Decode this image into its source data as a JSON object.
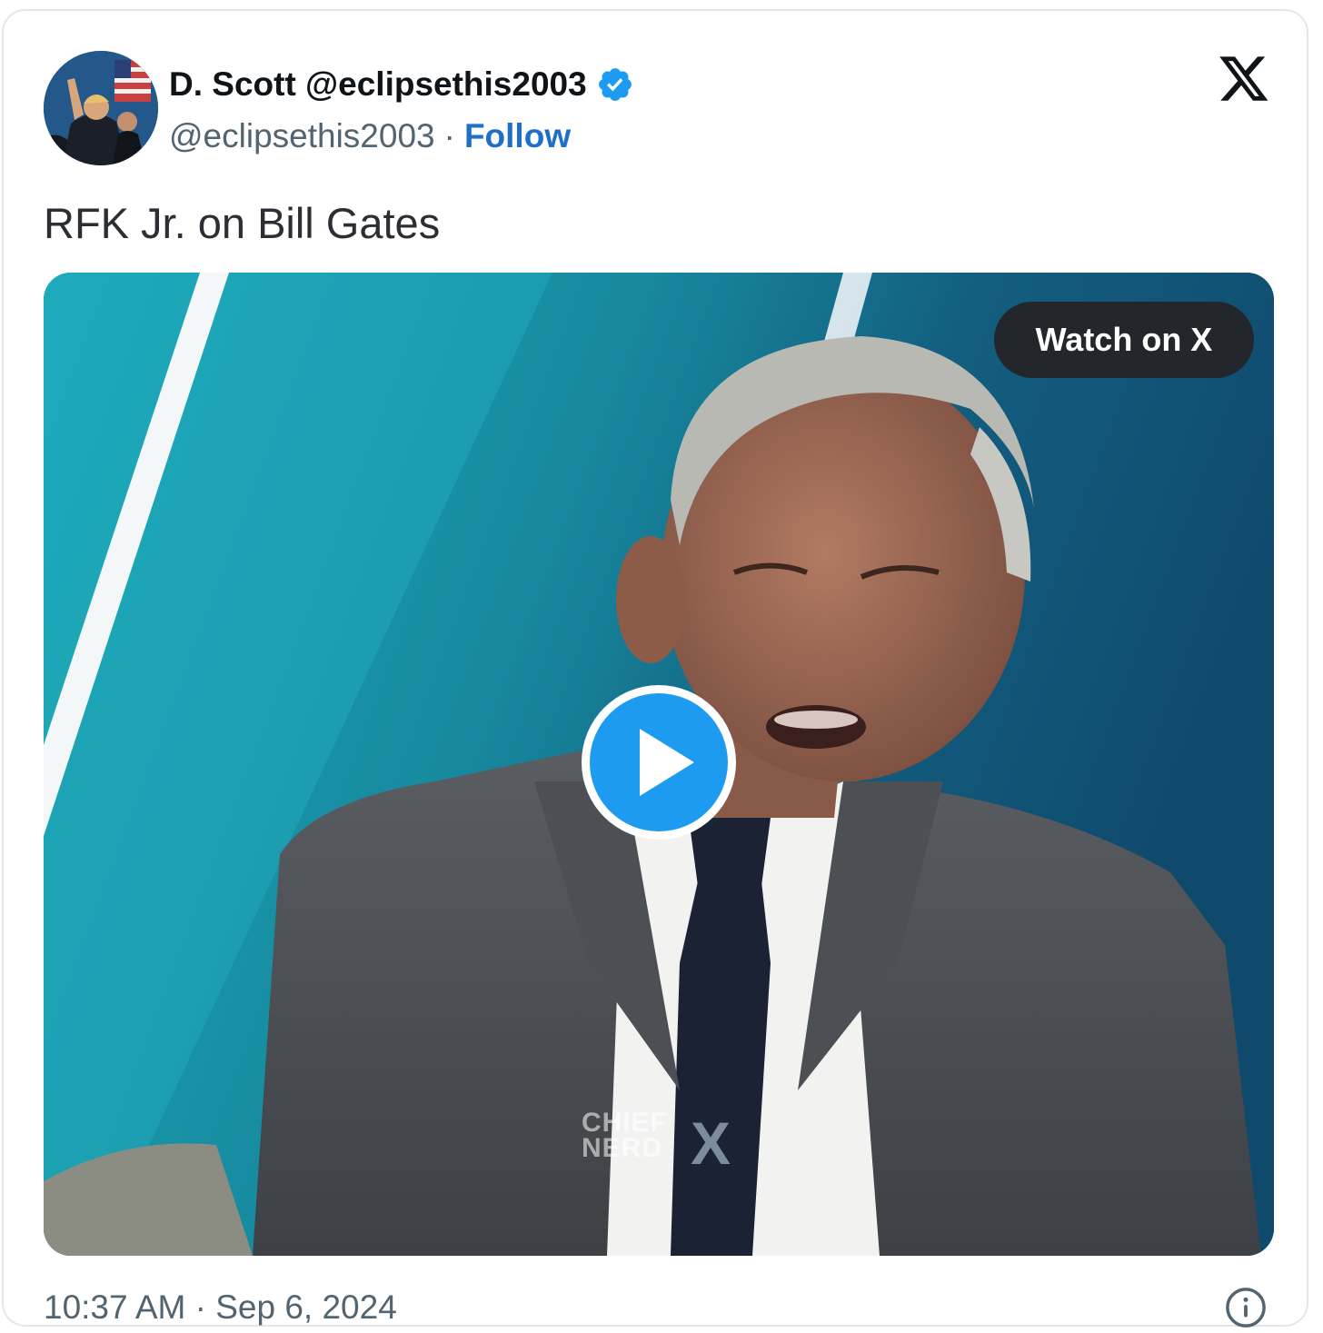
{
  "tweet": {
    "display_name": "D. Scott @eclipsethis2003",
    "handle": "@eclipsethis2003",
    "separator": "·",
    "follow_label": "Follow",
    "text": "RFK Jr. on Bill Gates",
    "timestamp": "10:37 AM · Sep 6, 2024",
    "verified": true
  },
  "media": {
    "watch_label": "Watch on X",
    "watermark_line1": "CHIEF",
    "watermark_line2": "NERD",
    "watermark_logo": "X",
    "play_icon": "play-icon"
  },
  "icons": {
    "brand": "x-logo-icon",
    "verified": "verified-badge-icon",
    "info": "info-icon"
  },
  "colors": {
    "follow": "#1d6fc7",
    "verified": "#1d9bf0",
    "play": "#1d9bf0",
    "text": "#0f1419",
    "muted": "#536471"
  }
}
